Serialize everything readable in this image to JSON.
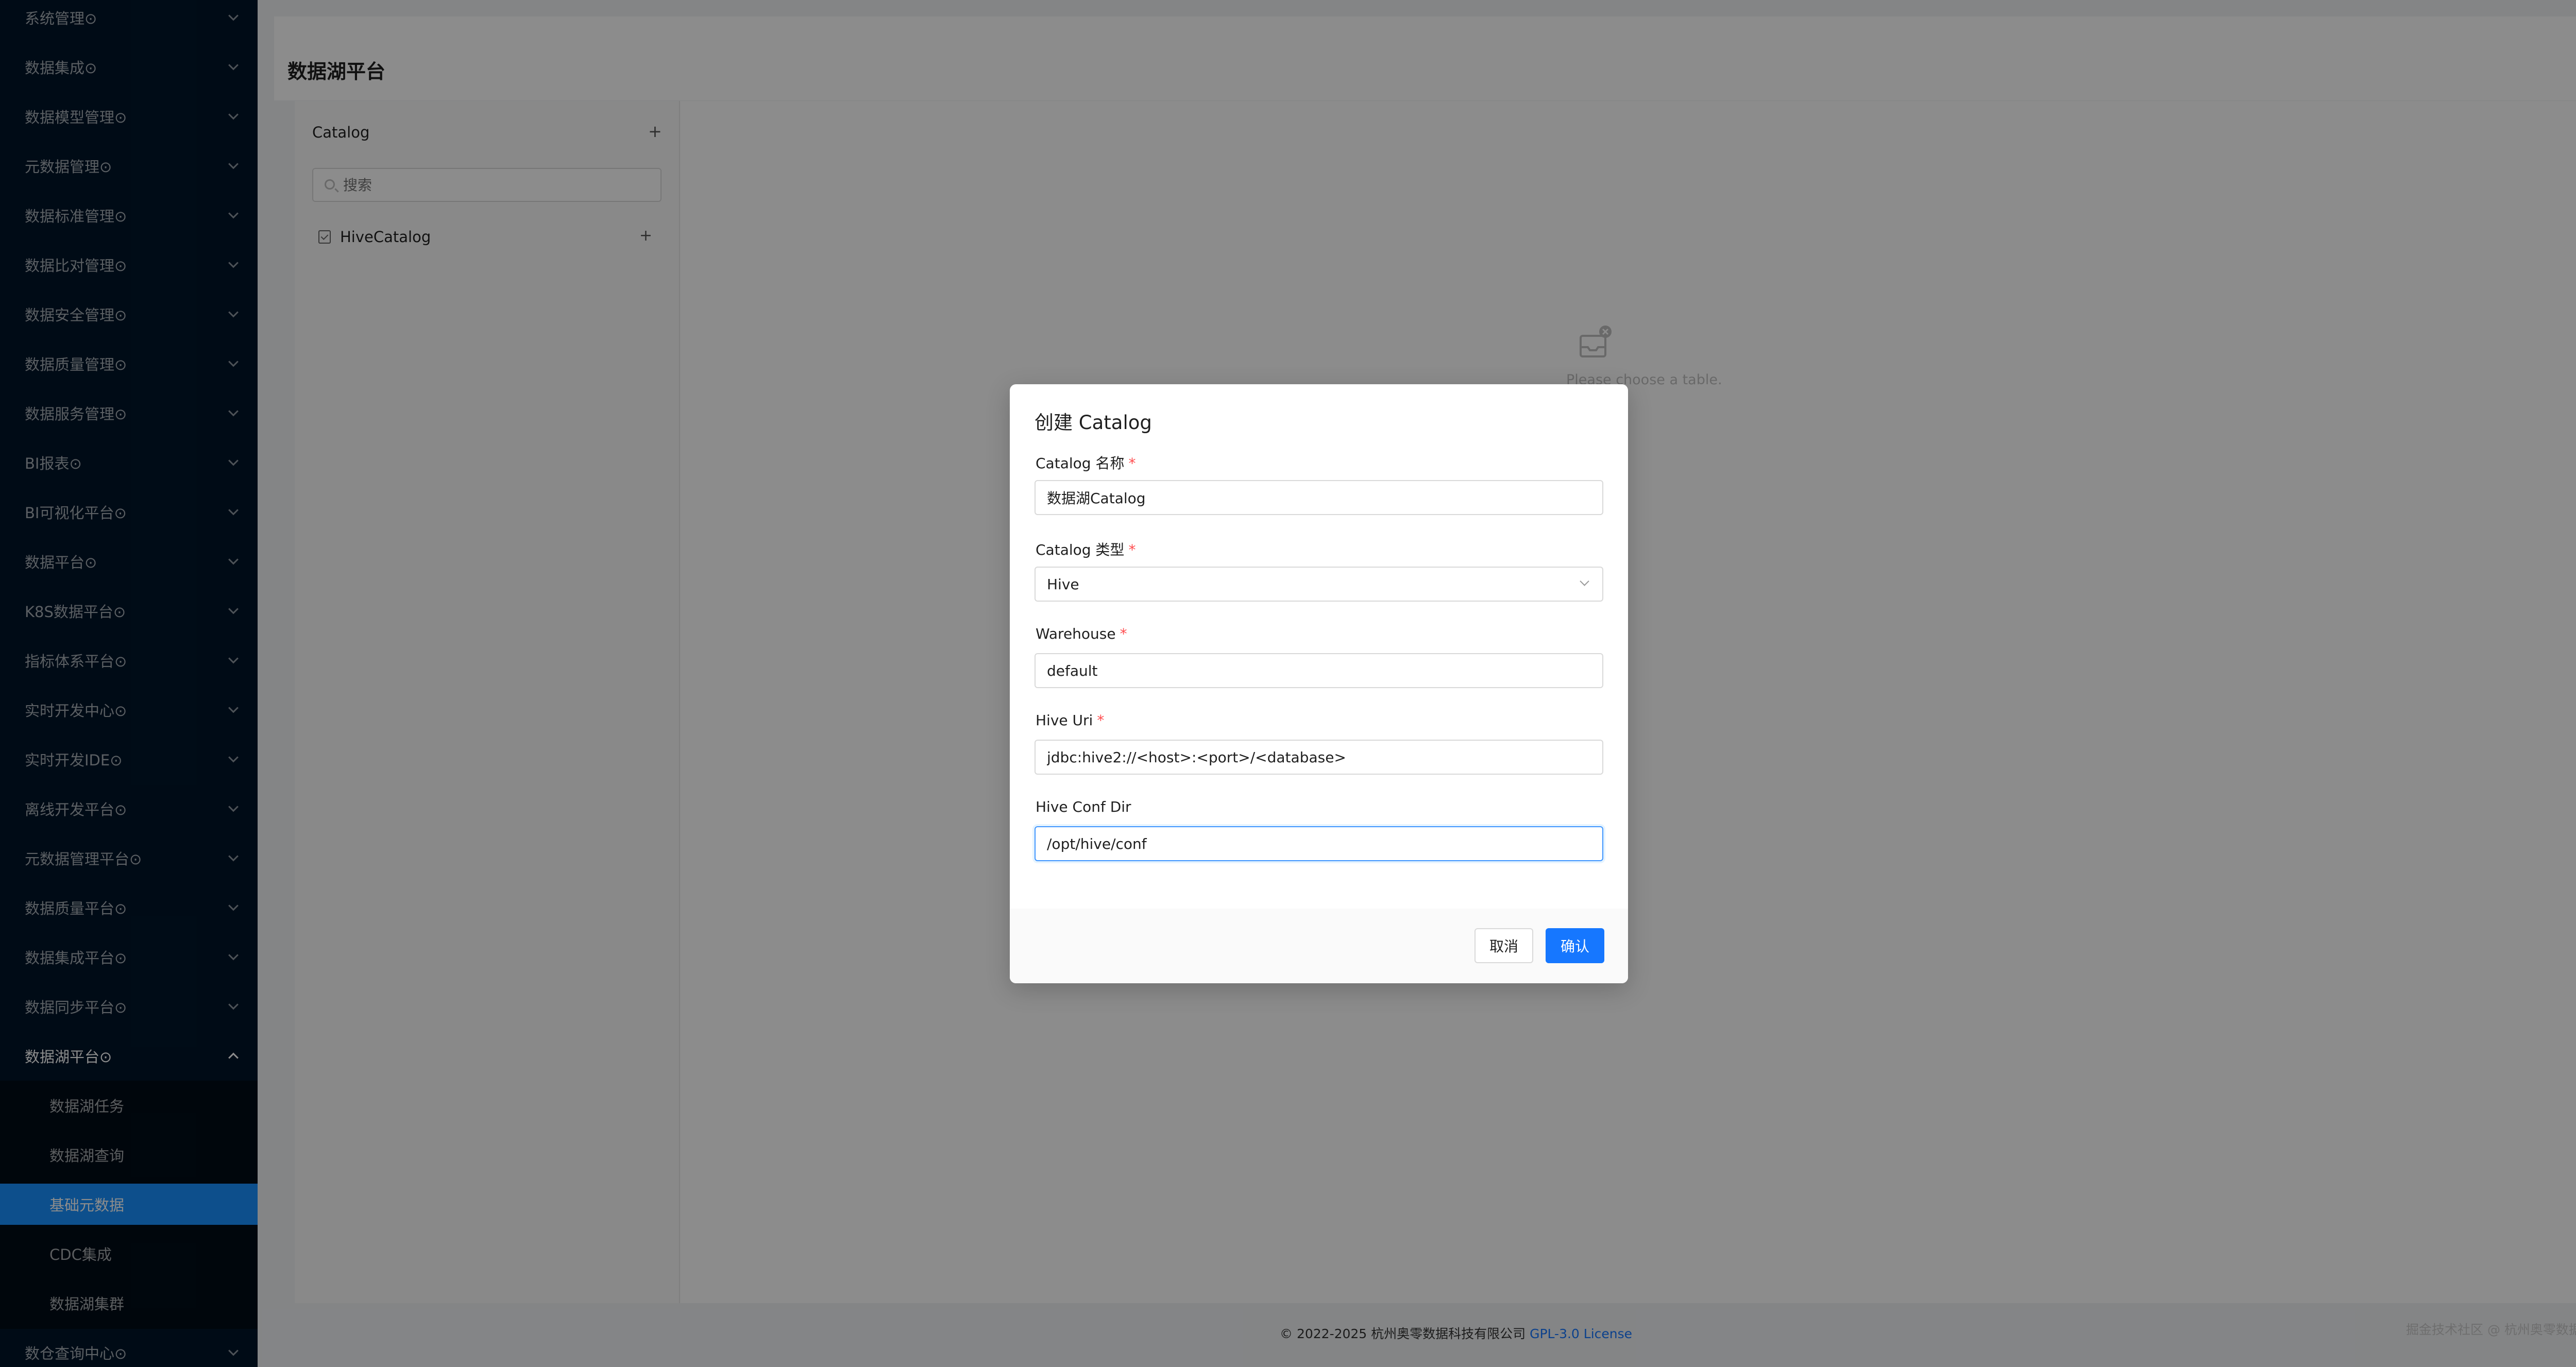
{
  "sidebar": {
    "items": [
      {
        "label": "系统管理⊙"
      },
      {
        "label": "数据集成⊙"
      },
      {
        "label": "数据模型管理⊙"
      },
      {
        "label": "元数据管理⊙"
      },
      {
        "label": "数据标准管理⊙"
      },
      {
        "label": "数据比对管理⊙"
      },
      {
        "label": "数据安全管理⊙"
      },
      {
        "label": "数据质量管理⊙"
      },
      {
        "label": "数据服务管理⊙"
      },
      {
        "label": "BI报表⊙"
      },
      {
        "label": "BI可视化平台⊙"
      },
      {
        "label": "数据平台⊙"
      },
      {
        "label": "K8S数据平台⊙"
      },
      {
        "label": "指标体系平台⊙"
      },
      {
        "label": "实时开发中心⊙"
      },
      {
        "label": "实时开发IDE⊙"
      },
      {
        "label": "离线开发平台⊙"
      },
      {
        "label": "元数据管理平台⊙"
      },
      {
        "label": "数据质量平台⊙"
      },
      {
        "label": "数据集成平台⊙"
      },
      {
        "label": "数据同步平台⊙"
      },
      {
        "label": "数据湖平台⊙"
      }
    ],
    "submenu": [
      {
        "label": "数据湖任务"
      },
      {
        "label": "数据湖查询"
      },
      {
        "label": "基础元数据"
      },
      {
        "label": "CDC集成"
      },
      {
        "label": "数据湖集群"
      }
    ],
    "last_item": {
      "label": "数仓查询中心⊙"
    }
  },
  "page": {
    "title": "数据湖平台",
    "catalog_panel": {
      "title": "Catalog",
      "add_symbol": "+",
      "search_placeholder": "搜索",
      "tree_item": "HiveCatalog",
      "tree_add_symbol": "+"
    },
    "empty_text": "Please choose a table.",
    "footer_text": "© 2022-2025 杭州奥零数据科技有限公司 ",
    "footer_link": "GPL-3.0 License",
    "watermark": "掘金技术社区 @ 杭州奥零数据科技"
  },
  "modal": {
    "title": "创建 Catalog",
    "fields": {
      "name": {
        "label": "Catalog 名称",
        "value": "数据湖Catalog"
      },
      "type": {
        "label": "Catalog 类型",
        "value": "Hive"
      },
      "warehouse": {
        "label": "Warehouse",
        "value": "default"
      },
      "hive_uri": {
        "label": "Hive Uri",
        "value": "jdbc:hive2://<host>:<port>/<database>"
      },
      "hive_conf_dir": {
        "label": "Hive Conf Dir",
        "value": "/opt/hive/conf"
      }
    },
    "required_mark": "*",
    "cancel_label": "取消",
    "ok_label": "确认"
  },
  "colors": {
    "sidebar_bg": "#001529",
    "submenu_bg": "#000c17",
    "active_item": "#1890ff",
    "primary": "#1677ff",
    "required": "#ff4d4f"
  }
}
